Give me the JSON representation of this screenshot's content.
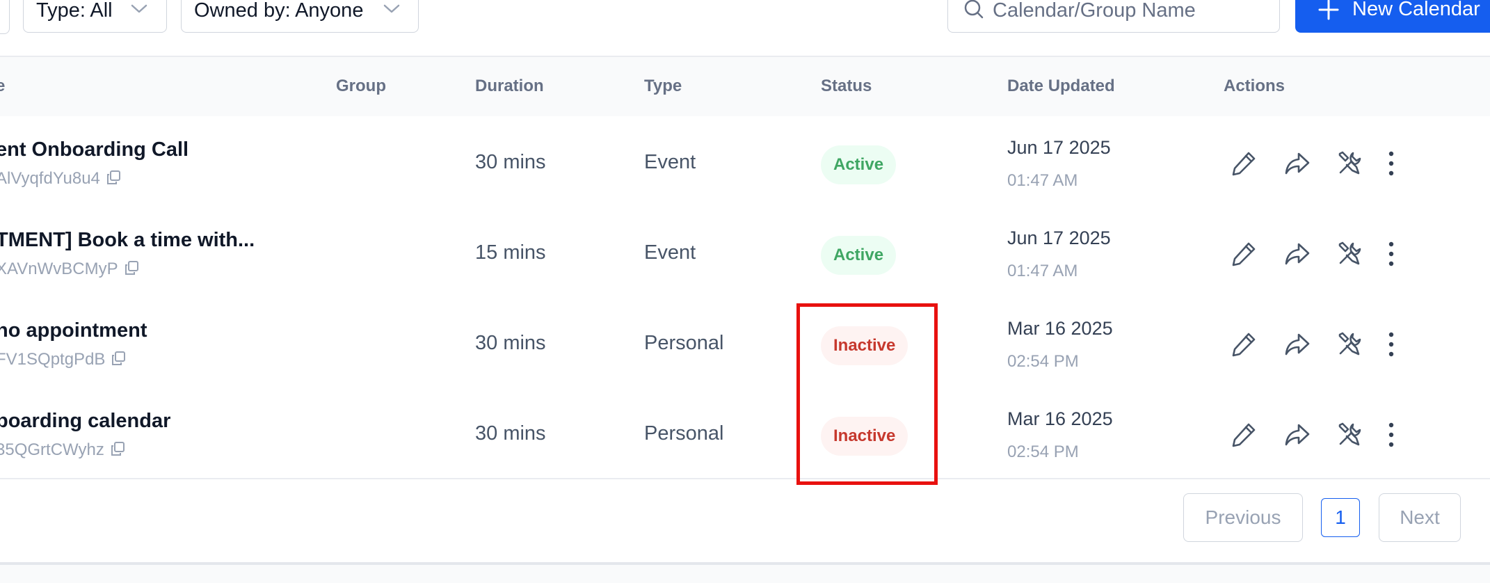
{
  "filters": {
    "type_label": "Type: All",
    "owner_label": "Owned by: Anyone"
  },
  "search": {
    "placeholder": "Calendar/Group Name"
  },
  "new_button_label": "New Calendar",
  "table": {
    "headers": {
      "name": "e",
      "group": "Group",
      "duration": "Duration",
      "type": "Type",
      "status": "Status",
      "date_updated": "Date Updated",
      "actions": "Actions"
    },
    "rows": [
      {
        "name": "ent Onboarding Call",
        "id": "AlVyqfdYu8u4",
        "group": "",
        "duration": "30 mins",
        "type": "Event",
        "status": "Active",
        "date": "Jun 17 2025",
        "time": "01:47 AM"
      },
      {
        "name": "TMENT] Book a time with...",
        "id": "XAVnWvBCMyP",
        "group": "",
        "duration": "15 mins",
        "type": "Event",
        "status": "Active",
        "date": "Jun 17 2025",
        "time": "01:47 AM"
      },
      {
        "name": "no appointment",
        "id": "FV1SQptgPdB",
        "group": "",
        "duration": "30 mins",
        "type": "Personal",
        "status": "Inactive",
        "date": "Mar 16 2025",
        "time": "02:54 PM"
      },
      {
        "name": "boarding calendar",
        "id": "35QGrtCWyhz",
        "group": "",
        "duration": "30 mins",
        "type": "Personal",
        "status": "Inactive",
        "date": "Mar 16 2025",
        "time": "02:54 PM"
      }
    ],
    "row_actions": [
      "pencil-icon",
      "share-icon",
      "tools-icon",
      "more-vertical-icon"
    ]
  },
  "pagination": {
    "previous": "Previous",
    "current_page": "1",
    "next": "Next"
  },
  "colors": {
    "primary": "#155eef",
    "active_text": "#3fa663",
    "active_bg": "#ecfdf3",
    "inactive_text": "#c6382d",
    "inactive_bg": "#fef3f2",
    "highlight": "#e8110f"
  }
}
